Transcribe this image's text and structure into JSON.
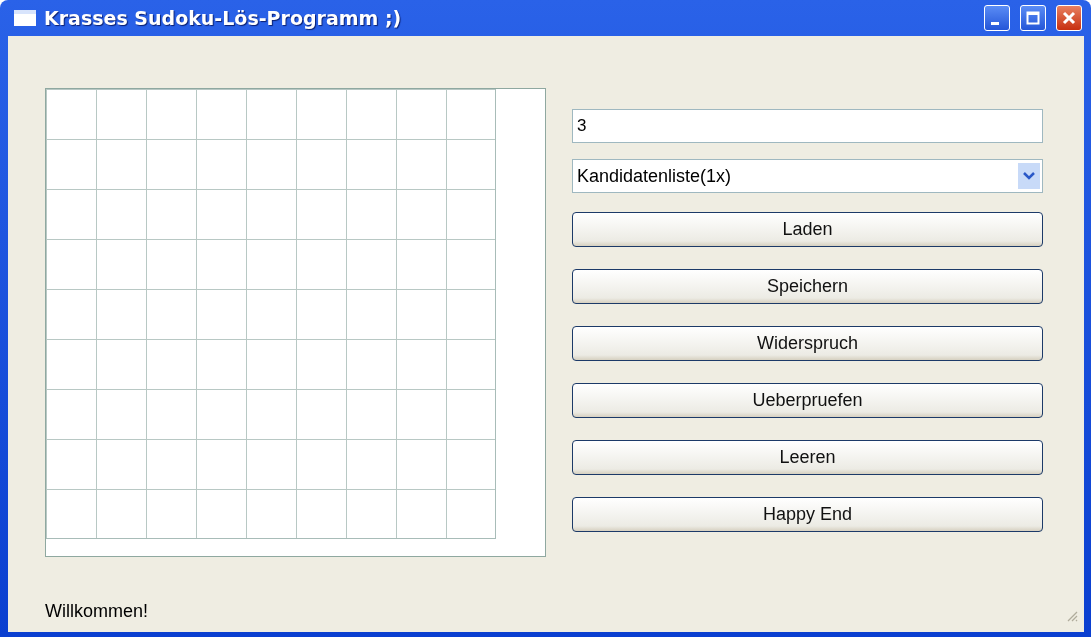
{
  "window": {
    "title": "Krasses Sudoku-Lös-Programm ;)"
  },
  "number_field": {
    "value": "3"
  },
  "mode_dropdown": {
    "value": "Kandidatenliste(1x)"
  },
  "buttons": [
    "Laden",
    "Speichern",
    "Widerspruch",
    "Ueberpruefen",
    "Leeren",
    "Happy End"
  ],
  "status_bar": {
    "text": "Willkommen!"
  }
}
